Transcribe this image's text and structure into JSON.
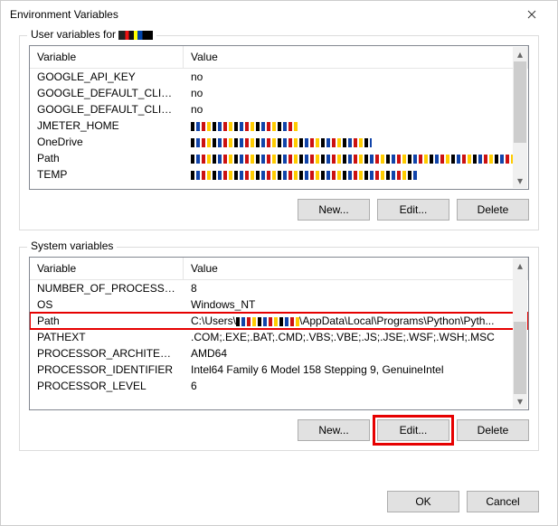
{
  "window": {
    "title": "Environment Variables"
  },
  "userbox": {
    "legend_prefix": "User variables for ",
    "header_var": "Variable",
    "header_val": "Value",
    "rows": [
      {
        "name": "GOOGLE_API_KEY",
        "value": "no",
        "pix": false
      },
      {
        "name": "GOOGLE_DEFAULT_CLIENT_ID",
        "value": "no",
        "pix": false
      },
      {
        "name": "GOOGLE_DEFAULT_CLIENT_...",
        "value": "no",
        "pix": false
      },
      {
        "name": "JMETER_HOME",
        "value": "",
        "pix": true,
        "pixw": 120
      },
      {
        "name": "OneDrive",
        "value": "",
        "pix": true,
        "pixw": 200
      },
      {
        "name": "Path",
        "value": "",
        "pix": true,
        "pixw": 360
      },
      {
        "name": "TEMP",
        "value": "",
        "pix": true,
        "pixw": 250
      }
    ],
    "buttons": {
      "new": "New...",
      "edit": "Edit...",
      "delete": "Delete"
    }
  },
  "sysbox": {
    "legend": "System variables",
    "header_var": "Variable",
    "header_val": "Value",
    "rows": [
      {
        "name": "NUMBER_OF_PROCESSORS",
        "value": "8"
      },
      {
        "name": "OS",
        "value": "Windows_NT"
      },
      {
        "name": "Path",
        "value_prefix": "C:\\Users\\",
        "value_suffix": "\\AppData\\Local\\Programs\\Python\\Pyth...",
        "highlight": true
      },
      {
        "name": "PATHEXT",
        "value": ".COM;.EXE;.BAT;.CMD;.VBS;.VBE;.JS;.JSE;.WSF;.WSH;.MSC"
      },
      {
        "name": "PROCESSOR_ARCHITECTURE",
        "value": "AMD64"
      },
      {
        "name": "PROCESSOR_IDENTIFIER",
        "value": "Intel64 Family 6 Model 158 Stepping 9, GenuineIntel"
      },
      {
        "name": "PROCESSOR_LEVEL",
        "value": "6"
      }
    ],
    "buttons": {
      "new": "New...",
      "edit": "Edit...",
      "delete": "Delete"
    }
  },
  "footer": {
    "ok": "OK",
    "cancel": "Cancel"
  }
}
